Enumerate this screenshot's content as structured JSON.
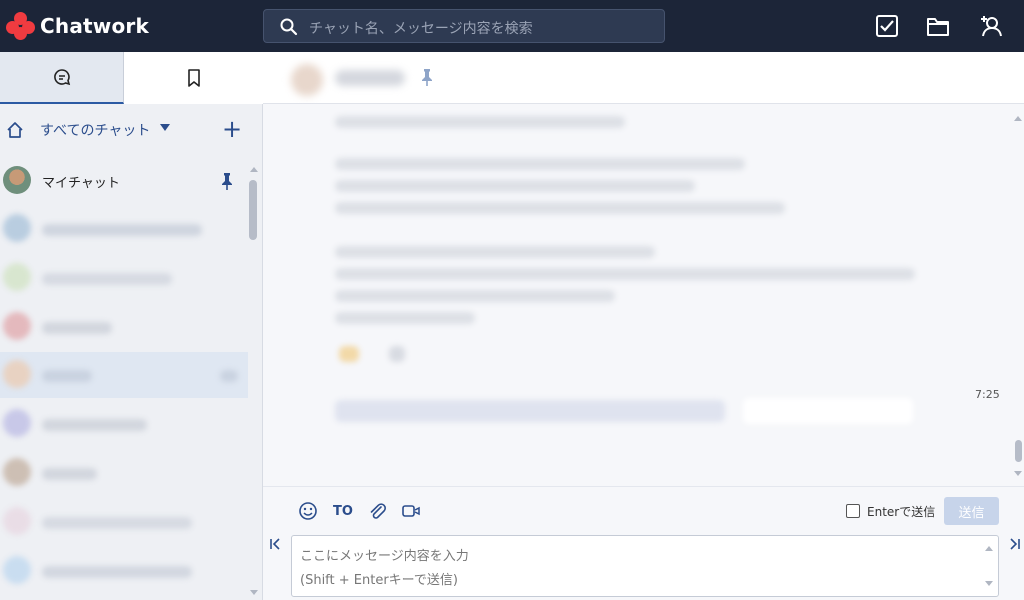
{
  "app": {
    "name": "Chatwork"
  },
  "search": {
    "placeholder": "チャット名、メッセージ内容を検索"
  },
  "header_icons": [
    "task-icon",
    "folder-icon",
    "add-contact-icon"
  ],
  "sidebar": {
    "tabs": [
      {
        "name": "chat-tab",
        "icon": "chat-bubble-icon",
        "active": true
      },
      {
        "name": "bookmark-tab",
        "icon": "bookmark-icon",
        "active": false
      }
    ],
    "filter_label": "すべてのチャット",
    "rooms": [
      {
        "label": "マイチャット",
        "pinned": true
      }
    ]
  },
  "timeline": {
    "time": "7:25"
  },
  "composer": {
    "to_label": "TO",
    "enter_send_label": "Enterで送信",
    "send_label": "送信",
    "placeholder_line1": "ここにメッセージ内容を入力",
    "placeholder_line2": "(Shift + Enterキーで送信)"
  },
  "colors": {
    "topbar": "#1c2538",
    "accent": "#2b4d8c",
    "logo": "#f03b40"
  }
}
